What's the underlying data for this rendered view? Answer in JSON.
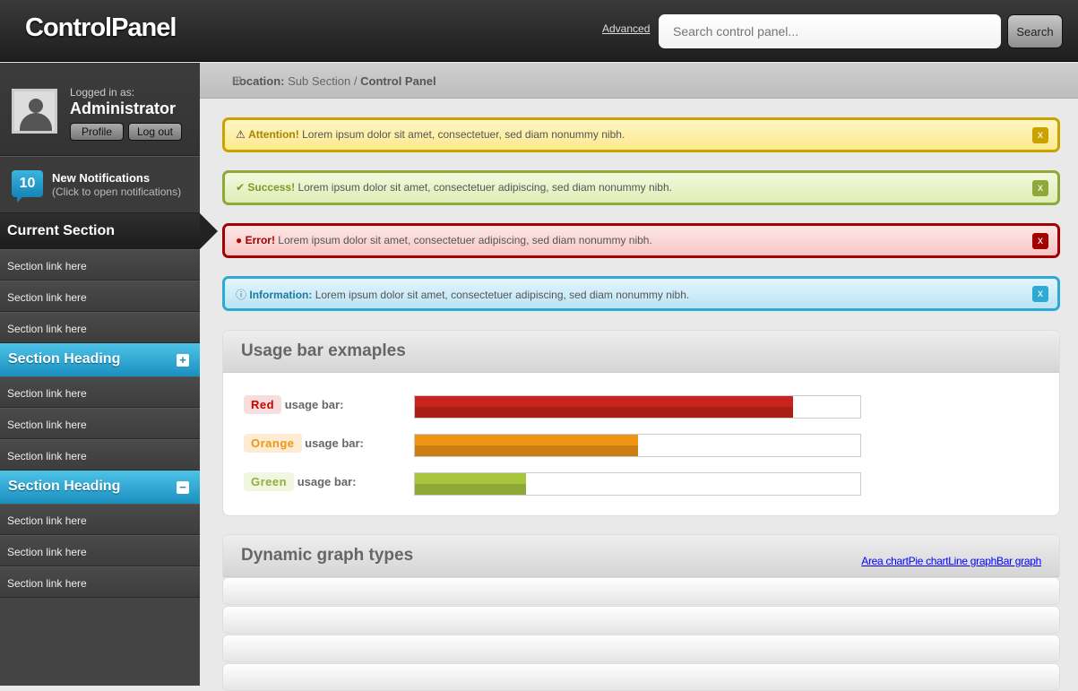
{
  "header": {
    "logo": "ControlPanel",
    "advanced": "Advanced",
    "search_placeholder": "Search control panel...",
    "search_button": "Search"
  },
  "user": {
    "logged_label": "Logged in as:",
    "name": "Administrator",
    "profile": "Profile",
    "logout": "Log out"
  },
  "notifications": {
    "count": "10",
    "title": "New Notifications",
    "subtitle": "(Click to open notifications)"
  },
  "sidebar": {
    "current": "Current Section",
    "group1": [
      "Section link here",
      "Section link here",
      "Section link here"
    ],
    "heading1": "Section Heading",
    "group2": [
      "Section link here",
      "Section link here",
      "Section link here"
    ],
    "heading2": "Section Heading",
    "group3": [
      "Section link here",
      "Section link here",
      "Section link here"
    ]
  },
  "breadcrumb": {
    "label": "Location:",
    "path": "Sub Section",
    "sep": "/",
    "current": "Control Panel"
  },
  "alerts": [
    {
      "title": "Attention!",
      "text": "Lorem ipsum dolor sit amet, consectetuer, sed diam nonummy nibh.",
      "close": "x",
      "color": "#c9a300"
    },
    {
      "title": "Success!",
      "text": "Lorem ipsum dolor sit amet, consectetuer adipiscing, sed diam nonummy nibh.",
      "close": "x",
      "color": "#8fa83a"
    },
    {
      "title": "Error!",
      "text": "Lorem ipsum dolor sit amet, consectetuer adipiscing, sed diam nonummy nibh.",
      "close": "x",
      "color": "#a30000"
    },
    {
      "title": "Information:",
      "text": "Lorem ipsum dolor sit amet, consectetuer adipiscing, sed diam nonummy nibh.",
      "close": "x",
      "color": "#2ea9d4"
    }
  ],
  "usage": {
    "title": "Usage bar exmaples",
    "suffix": "usage bar:",
    "bars": [
      {
        "tag": "Red",
        "percent": 85,
        "color": "#c8231c"
      },
      {
        "tag": "Orange",
        "percent": 50,
        "color": "#ef9515"
      },
      {
        "tag": "Green",
        "percent": 25,
        "color": "#a8c53e"
      }
    ]
  },
  "graphs": {
    "title": "Dynamic graph types",
    "links": "Area chartPie chartLine graphBar graph"
  }
}
